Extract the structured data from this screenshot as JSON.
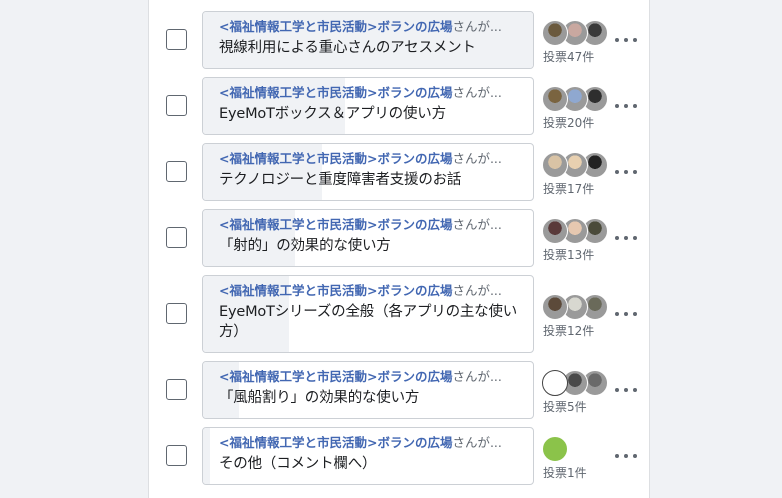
{
  "options": [
    {
      "added_by": "<福祉情報工学と市民活動>ボランの広場",
      "added_by_suffix": "さんが...",
      "label": "視線利用による重心さんのアセスメント",
      "votes": "投票47件",
      "vote_share": 1.0,
      "avatar_icons": [
        "person-photo-icon",
        "person-photo-icon",
        "person-photo-icon"
      ]
    },
    {
      "added_by": "<福祉情報工学と市民活動>ボランの広場",
      "added_by_suffix": "さんが...",
      "label": "EyeMoTボックス＆アプリの使い方",
      "votes": "投票20件",
      "vote_share": 0.43,
      "avatar_icons": [
        "person-photo-icon",
        "cartoon-avatar-icon",
        "person-photo-icon"
      ]
    },
    {
      "added_by": "<福祉情報工学と市民活動>ボランの広場",
      "added_by_suffix": "さんが...",
      "label": "テクノロジーと重度障害者支援のお話",
      "votes": "投票17件",
      "vote_share": 0.36,
      "avatar_icons": [
        "dog-photo-icon",
        "person-photo-icon",
        "person-photo-icon"
      ]
    },
    {
      "added_by": "<福祉情報工学と市民活動>ボランの広場",
      "added_by_suffix": "さんが...",
      "label": "「射的」の効果的な使い方",
      "votes": "投票13件",
      "vote_share": 0.28,
      "avatar_icons": [
        "person-photo-icon",
        "person-photo-icon",
        "person-photo-icon"
      ]
    },
    {
      "added_by": "<福祉情報工学と市民活動>ボランの広場",
      "added_by_suffix": "さんが...",
      "label": "EyeMoTシリーズの全般（各アプリの主な使い方）",
      "votes": "投票12件",
      "vote_share": 0.26,
      "avatar_icons": [
        "person-photo-icon",
        "dog-photo-icon",
        "person-photo-icon"
      ]
    },
    {
      "added_by": "<福祉情報工学と市民活動>ボランの広場",
      "added_by_suffix": "さんが...",
      "label": "「風船割り」の効果的な使い方",
      "votes": "投票5件",
      "vote_share": 0.11,
      "avatar_icons": [
        "drawn-face-icon",
        "person-photo-icon",
        "person-photo-icon"
      ]
    },
    {
      "added_by": "<福祉情報工学と市民活動>ボランの広場",
      "added_by_suffix": "さんが...",
      "label": "その他（コメント欄へ）",
      "votes": "投票1件",
      "vote_share": 0.02,
      "avatar_icons": [
        "green-circle-avatar-icon"
      ]
    }
  ],
  "more_icon": "more-horizontal-icon",
  "colors": {
    "link": "#4267b2",
    "fill": "#f0f2f5",
    "text": "#1c1e21",
    "muted": "#606770"
  }
}
